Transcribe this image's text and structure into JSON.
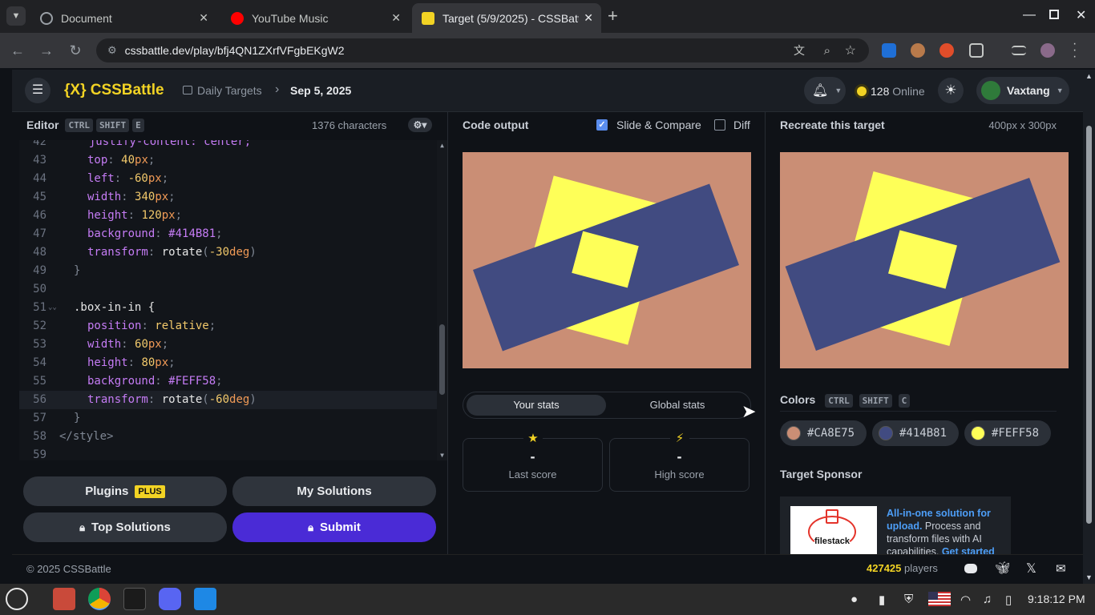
{
  "browser": {
    "tabs": [
      {
        "title": "Document"
      },
      {
        "title": "YouTube Music"
      },
      {
        "title": "Target (5/9/2025) - CSSBattl"
      }
    ],
    "url": "cssbattle.dev/play/bfj4QN1ZXrfVFgbEKgW2"
  },
  "topnav": {
    "brand": "{X} CSSBattle",
    "breadcrumb_1": "Daily Targets",
    "breadcrumb_2": "Sep 5, 2025",
    "online_count": "128",
    "online_label": "Online",
    "username": "Vaxtang"
  },
  "editor": {
    "title": "Editor",
    "shortcut": [
      "CTRL",
      "SHIFT",
      "E"
    ],
    "char_count": "1376 characters",
    "lines": [
      {
        "n": "42",
        "text": "  justify-content: center;"
      },
      {
        "n": "43",
        "p": "top",
        "v": "40",
        "u": "px"
      },
      {
        "n": "44",
        "p": "left",
        "v": "-60",
        "u": "px"
      },
      {
        "n": "45",
        "p": "width",
        "v": "340",
        "u": "px"
      },
      {
        "n": "46",
        "p": "height",
        "v": "120",
        "u": "px"
      },
      {
        "n": "47",
        "p": "background",
        "v": "#414B81",
        "u": ""
      },
      {
        "n": "48",
        "p": "transform",
        "fn": "rotate",
        "v": "-30",
        "u": "deg"
      },
      {
        "n": "49",
        "text": "}"
      },
      {
        "n": "50",
        "text": ""
      },
      {
        "n": "51",
        "text": ".box-in-in {"
      },
      {
        "n": "52",
        "p": "position",
        "v": "relative",
        "u": ""
      },
      {
        "n": "53",
        "p": "width",
        "v": "60",
        "u": "px"
      },
      {
        "n": "54",
        "p": "height",
        "v": "80",
        "u": "px"
      },
      {
        "n": "55",
        "p": "background",
        "v": "#FEFF58",
        "u": ""
      },
      {
        "n": "56",
        "p": "transform",
        "fn": "rotate",
        "v": "-60",
        "u": "deg"
      },
      {
        "n": "57",
        "text": "}"
      },
      {
        "n": "58",
        "text": "</style>"
      },
      {
        "n": "59",
        "text": ""
      }
    ]
  },
  "buttons": {
    "plugins": "Plugins",
    "plus_badge": "PLUS",
    "my_solutions": "My Solutions",
    "top_solutions": "Top Solutions",
    "submit": "Submit"
  },
  "output": {
    "title": "Code output",
    "slide_compare": "Slide & Compare",
    "diff": "Diff",
    "tab_your": "Your stats",
    "tab_global": "Global stats",
    "last_score_value": "-",
    "last_score_label": "Last score",
    "high_score_value": "-",
    "high_score_label": "High score"
  },
  "target": {
    "title": "Recreate this target",
    "size": "400px x 300px",
    "colors_title": "Colors",
    "colors_shortcut": [
      "CTRL",
      "SHIFT",
      "C"
    ],
    "colors": [
      "#CA8E75",
      "#414B81",
      "#FEFF58"
    ],
    "sponsor_title": "Target Sponsor",
    "sponsor_logo": "filestack",
    "sponsor_text_link": "All-in-one solution for upload.",
    "sponsor_text": " Process and transform files with AI capabilities.",
    "sponsor_cta": "Get started"
  },
  "footer": {
    "copyright": "© 2025 CSSBattle",
    "players_count": "427425",
    "players_label": "players"
  },
  "taskbar": {
    "time": "9:18:12 PM"
  }
}
